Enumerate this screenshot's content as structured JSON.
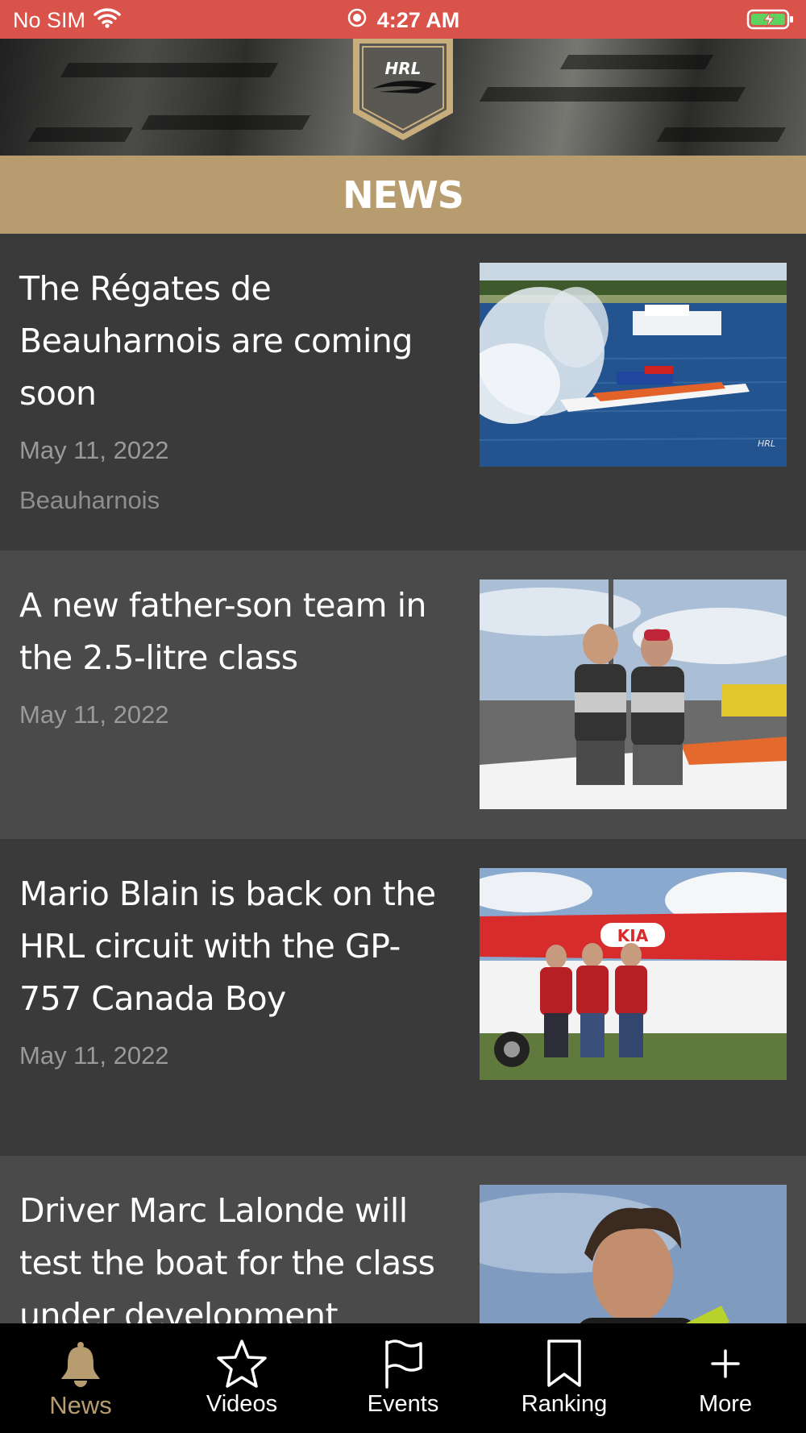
{
  "status_bar": {
    "carrier": "No SIM",
    "time": "4:27 AM"
  },
  "header": {
    "logo_text": "HRL"
  },
  "section": {
    "title": "NEWS"
  },
  "news": [
    {
      "title": "The Régates de Beauharnois are coming soon",
      "date": "May 11, 2022",
      "tag": "Beauharnois",
      "image": "hydroplane-race-spray"
    },
    {
      "title": "A new father-son team in the 2.5-litre class",
      "date": "May 11, 2022",
      "image": "father-son-team-photo"
    },
    {
      "title": "Mario Blain is back on the HRL circuit with the GP-757 Canada Boy",
      "date": "May 11, 2022",
      "image": "kia-boat-team-photo"
    },
    {
      "title": "Driver Marc Lalonde will test the boat for the class under development",
      "image": "driver-portrait"
    }
  ],
  "tabs": [
    {
      "label": "News",
      "icon": "bell-icon",
      "active": true
    },
    {
      "label": "Videos",
      "icon": "star-icon",
      "active": false
    },
    {
      "label": "Events",
      "icon": "flag-icon",
      "active": false
    },
    {
      "label": "Ranking",
      "icon": "bookmark-icon",
      "active": false
    },
    {
      "label": "More",
      "icon": "plus-icon",
      "active": false
    }
  ],
  "colors": {
    "status_bar": "#d9534a",
    "accent_gold": "#b79c6f",
    "item_dark": "#3a3a3a",
    "item_light": "#4a4a4a",
    "tab_bar": "#000000"
  }
}
